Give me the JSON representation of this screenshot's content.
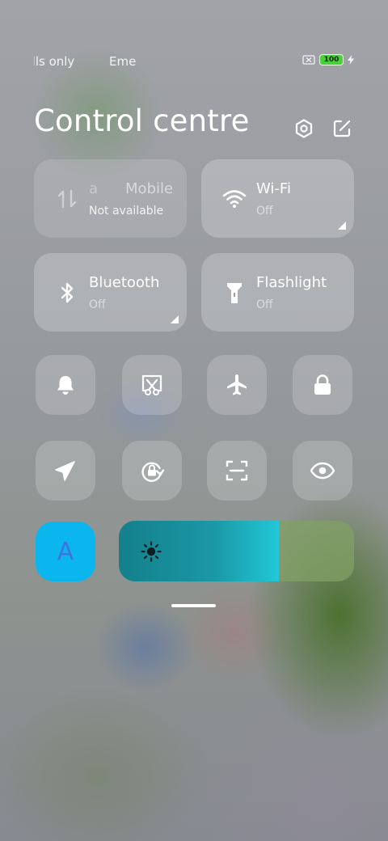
{
  "status_bar": {
    "carrier_1": "Calls only",
    "carrier_2": "Emergency calls only",
    "battery": "100",
    "icons": [
      "no-sim-icon",
      "battery-icon",
      "charging-icon"
    ]
  },
  "header": {
    "title": "Control centre",
    "icons": [
      "settings-icon",
      "edit-icon"
    ]
  },
  "tiles": [
    {
      "id": "mobile-data",
      "label": "Mobile data",
      "ghost": "a",
      "status": "Not available",
      "icon": "mobile-data-icon"
    },
    {
      "id": "wifi",
      "label": "Wi-Fi",
      "status": "Off",
      "icon": "wifi-icon"
    },
    {
      "id": "bluetooth",
      "label": "Bluetooth",
      "status": "Off",
      "icon": "bluetooth-icon"
    },
    {
      "id": "flashlight",
      "label": "Flashlight",
      "status": "Off",
      "icon": "flashlight-icon"
    }
  ],
  "quick_toggles": [
    "bell-icon",
    "screenshot-icon",
    "airplane-icon",
    "lock-icon",
    "location-icon",
    "rotation-lock-icon",
    "scanner-icon",
    "eye-icon"
  ],
  "brightness": {
    "auto_label": "A",
    "level": 0.68,
    "icon": "sun-icon"
  },
  "colors": {
    "accent": "#0bb6ee",
    "slider_fill": "#1a98a6",
    "battery": "#48d03a"
  }
}
